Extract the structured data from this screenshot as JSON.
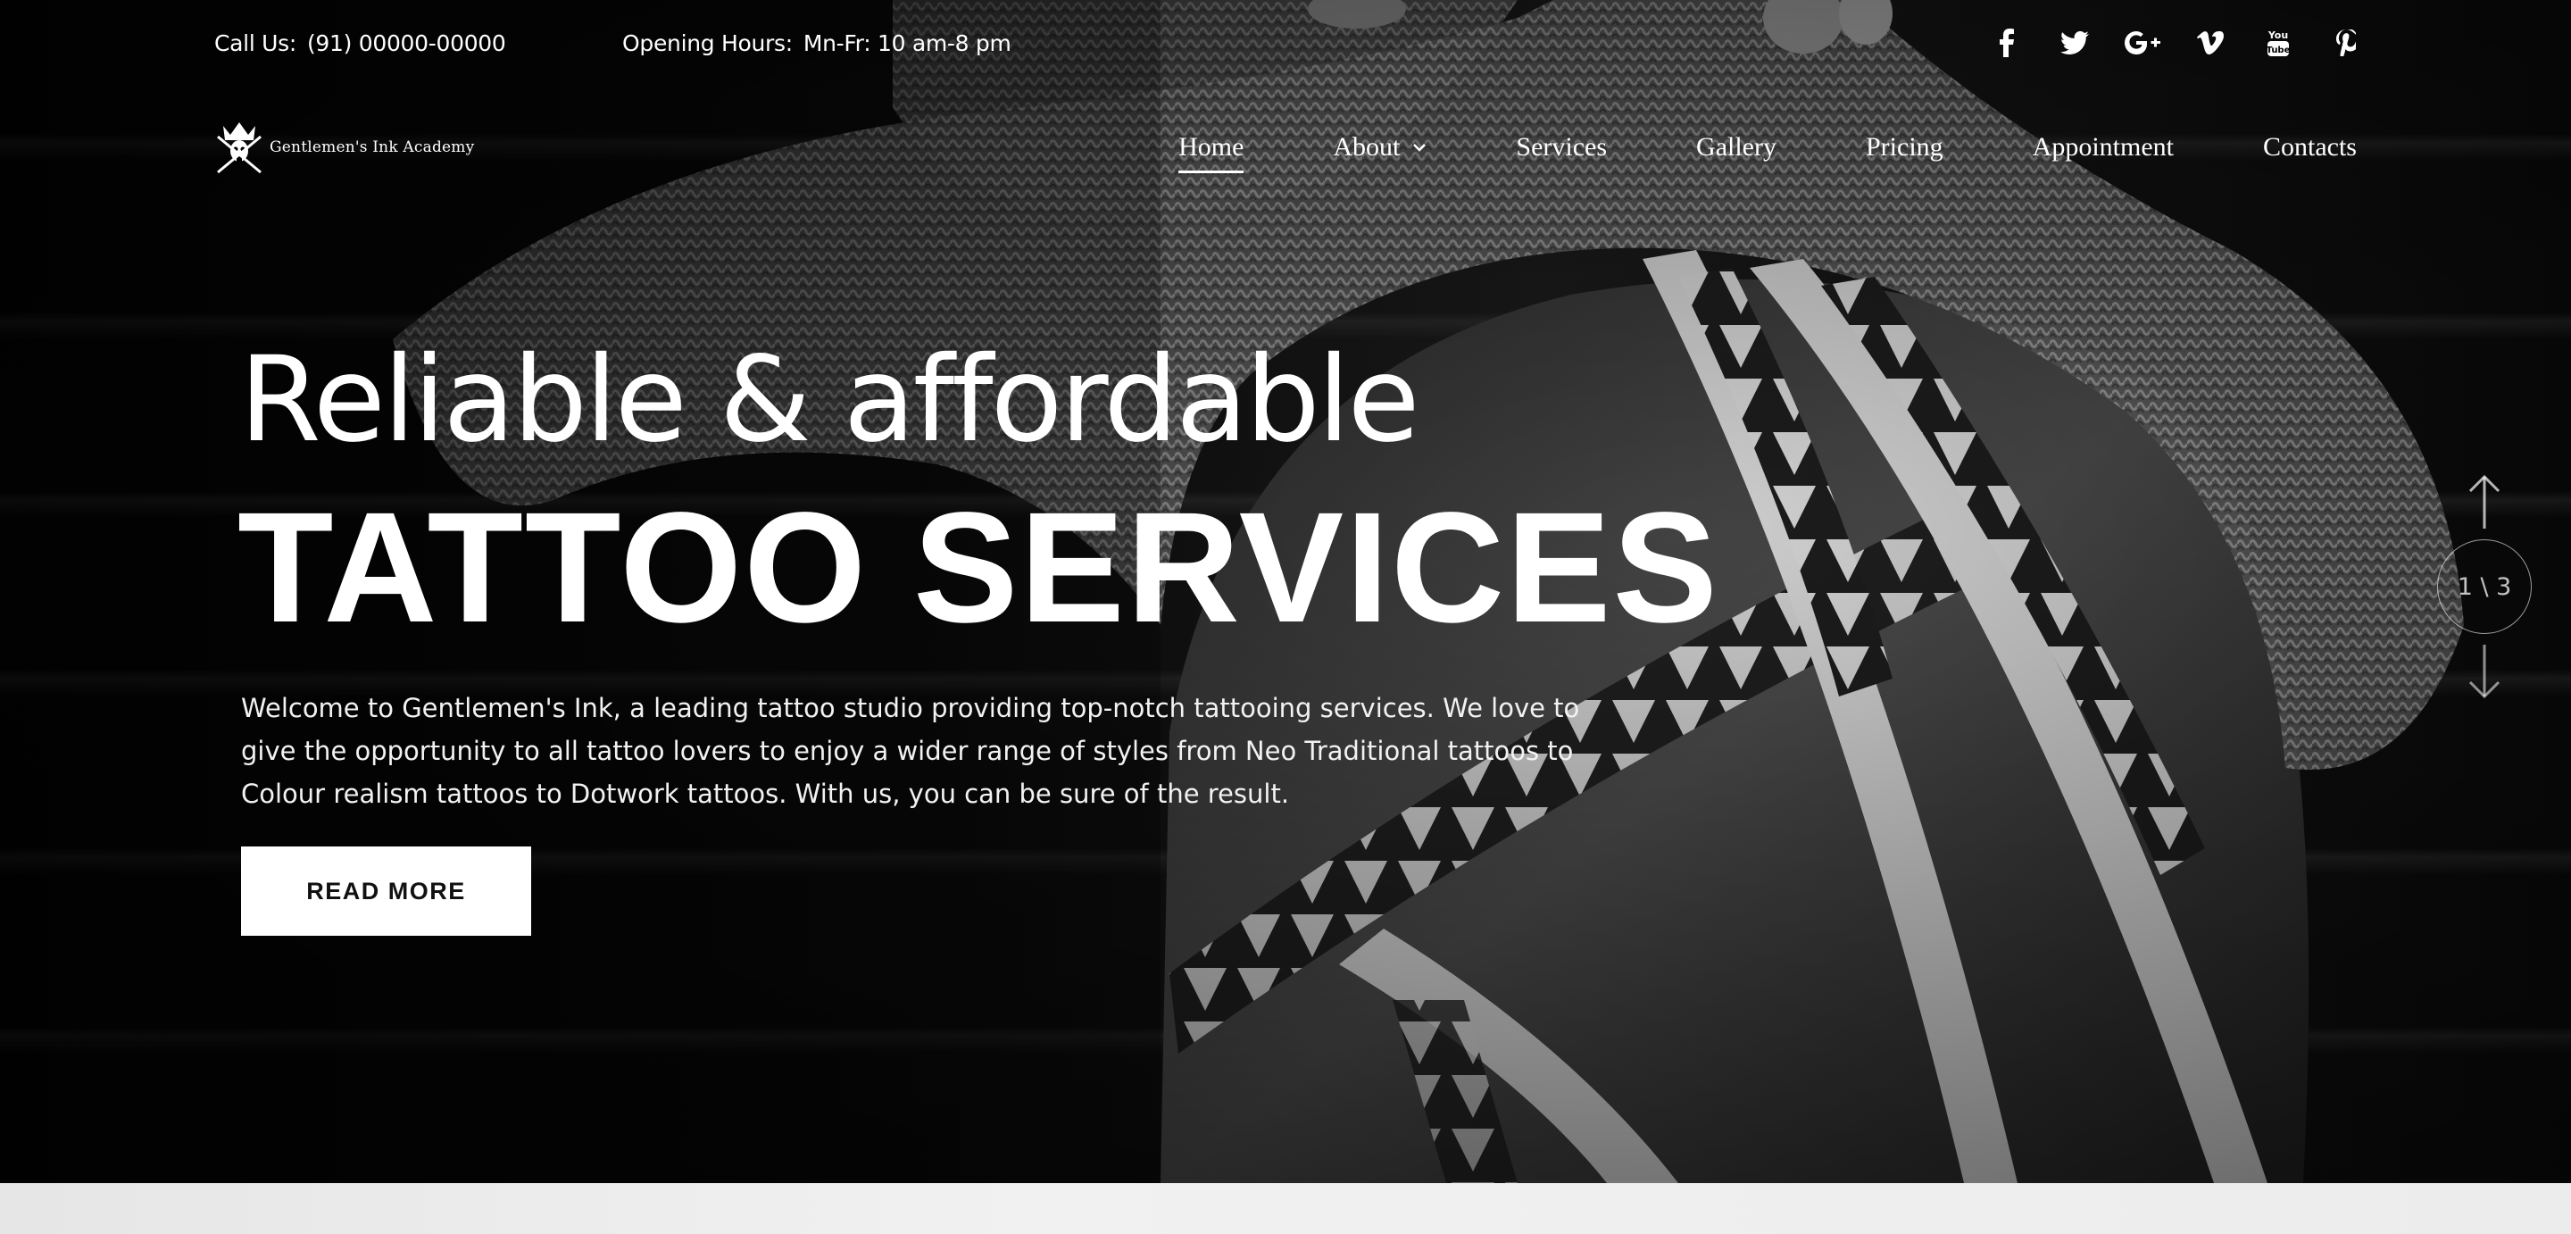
{
  "topbar": {
    "call_label": "Call Us:",
    "call_value": "(91) 00000-00000",
    "hours_label": "Opening Hours:",
    "hours_value": "Mn-Fr: 10 am-8 pm"
  },
  "social": {
    "icons": [
      "facebook-icon",
      "twitter-icon",
      "google-plus-icon",
      "vimeo-icon",
      "youtube-icon",
      "pinterest-icon"
    ],
    "glyphs": [
      "f",
      "t",
      "G+",
      "V",
      "You",
      "P"
    ]
  },
  "brand": {
    "name": "Gentlemen's Ink Academy"
  },
  "nav": {
    "items": [
      {
        "label": "Home",
        "active": true
      },
      {
        "label": "About",
        "has_dropdown": true
      },
      {
        "label": "Services"
      },
      {
        "label": "Gallery"
      },
      {
        "label": "Pricing"
      },
      {
        "label": "Appointment"
      },
      {
        "label": "Contacts"
      }
    ]
  },
  "hero": {
    "headline_1": "Reliable & affordable",
    "headline_2": "TATTOO SERVICES",
    "intro": "Welcome to Gentlemen's Ink, a leading tattoo studio providing top-notch tattooing services. We love to give the opportunity to all tattoo lovers to enjoy a wider range of styles from Neo Traditional tattoos to Colour realism tattoos to Dotwork tattoos. With us, you can be sure of the result.",
    "cta_label": "READ MORE"
  },
  "slider": {
    "counter": "1 \\ 3"
  },
  "colors": {
    "text": "#ffffff",
    "background": "#000000",
    "cta_bg": "#ffffff",
    "cta_text": "#111111"
  }
}
